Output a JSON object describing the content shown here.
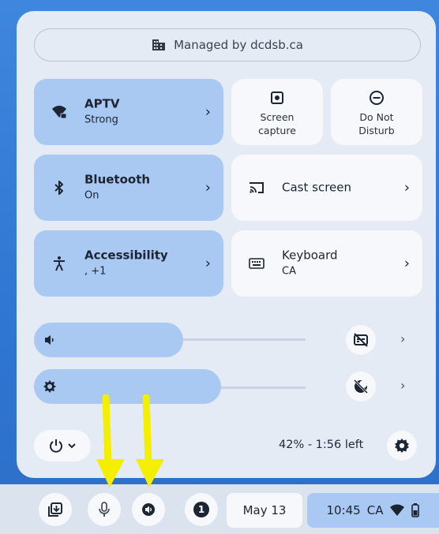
{
  "managed": {
    "text": "Managed by dcdsb.ca",
    "icon": "building-icon"
  },
  "tiles": {
    "wifi": {
      "title": "APTV",
      "sub": "Strong"
    },
    "screen_capture": {
      "line1": "Screen",
      "line2": "capture"
    },
    "dnd": {
      "line1": "Do Not",
      "line2": "Disturb"
    },
    "bluetooth": {
      "title": "Bluetooth",
      "sub": "On"
    },
    "cast": {
      "title": "Cast screen"
    },
    "accessibility": {
      "title": "Accessibility",
      "sub": ", +1"
    },
    "keyboard": {
      "title": "Keyboard",
      "sub": "CA"
    }
  },
  "sliders": {
    "volume": {
      "level": 0.55
    },
    "brightness": {
      "level": 0.69
    }
  },
  "battery": {
    "text": "42% - 1:56 left"
  },
  "shelf": {
    "date": "May 13",
    "time": "10:45",
    "region": "CA",
    "notifications": "1"
  },
  "colors": {
    "accent": "#a9c8f2",
    "panel": "#e4ebf5",
    "arrow": "#f4ee00"
  }
}
